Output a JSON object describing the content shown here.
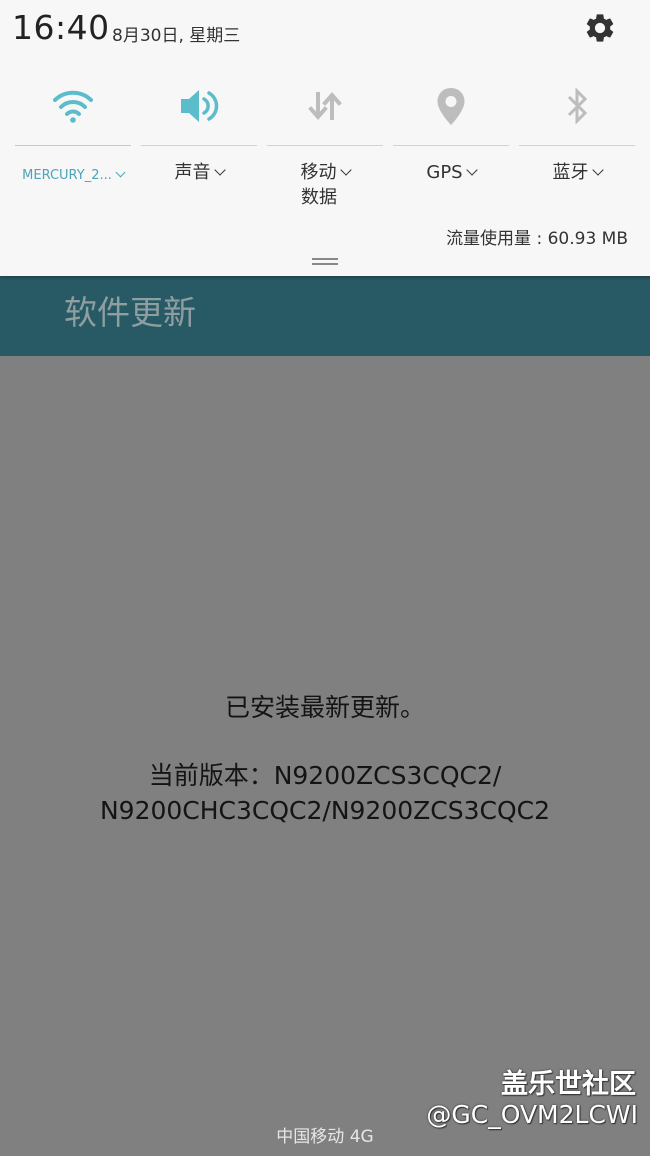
{
  "status_bar": {
    "time": "16:40",
    "date": "8月30日, 星期三"
  },
  "quick_settings": {
    "tiles": [
      {
        "id": "wifi",
        "label": "MERCURY_2...",
        "icon": "wifi-icon",
        "active": true
      },
      {
        "id": "sound",
        "label": "声音",
        "icon": "speaker-icon",
        "active": false
      },
      {
        "id": "mobile_data",
        "label_line1": "移动",
        "label_line2": "数据",
        "icon": "mobile-data-icon",
        "active": false
      },
      {
        "id": "gps",
        "label": "GPS",
        "icon": "location-pin-icon",
        "active": false
      },
      {
        "id": "bluetooth",
        "label": "蓝牙",
        "icon": "bluetooth-icon",
        "active": false
      }
    ],
    "data_usage": "流量使用量 : 60.93 MB",
    "colors": {
      "active": "#4aa5b7",
      "inactive_icon": "#bdbdbd",
      "panel_bg": "#f7f7f7"
    }
  },
  "app": {
    "title": "软件更新",
    "header_color": "#285a66",
    "message_line1": "已安装最新更新。",
    "message_line2": "当前版本：N9200ZCS3CQC2/",
    "message_line3": "N9200CHC3CQC2/N9200ZCS3CQC2"
  },
  "bottom": {
    "carrier": "中国移动 4G"
  },
  "watermark": {
    "title": "盖乐世社区",
    "user": "@GC_OVM2LCWI"
  }
}
